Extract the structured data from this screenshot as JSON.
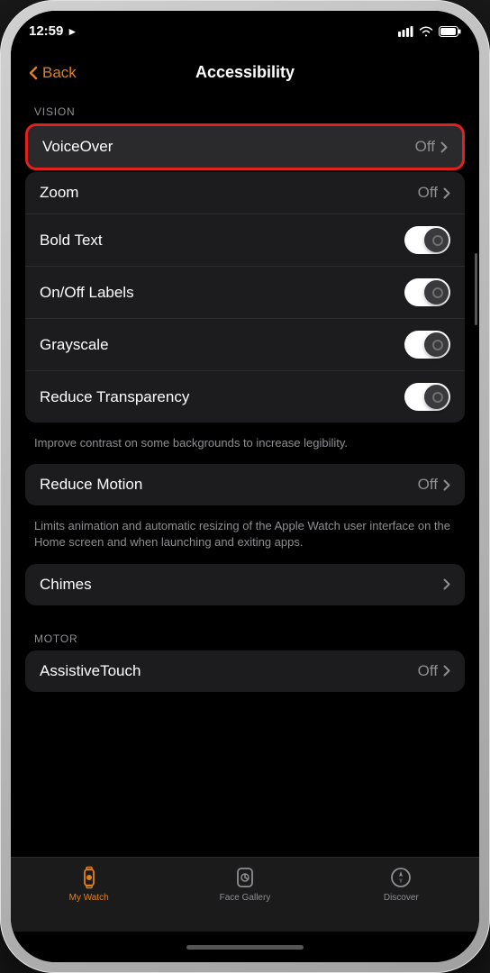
{
  "phone": {
    "status": {
      "time": "12:59",
      "location_icon": "▶",
      "signal": "●●●",
      "wifi": "wifi",
      "battery": "battery"
    }
  },
  "header": {
    "back_label": "Back",
    "title": "Accessibility"
  },
  "vision_section": {
    "header": "VISION",
    "items": [
      {
        "label": "VoiceOver",
        "value": "Off",
        "type": "chevron",
        "highlight": true
      },
      {
        "label": "Zoom",
        "value": "Off",
        "type": "chevron"
      },
      {
        "label": "Bold Text",
        "value": "",
        "type": "toggle"
      },
      {
        "label": "On/Off Labels",
        "value": "",
        "type": "toggle"
      },
      {
        "label": "Grayscale",
        "value": "",
        "type": "toggle"
      },
      {
        "label": "Reduce Transparency",
        "value": "",
        "type": "toggle"
      }
    ],
    "hint": "Improve contrast on some backgrounds to increase legibility."
  },
  "reduce_motion": {
    "label": "Reduce Motion",
    "value": "Off",
    "hint": "Limits animation and automatic resizing of the Apple Watch user interface on the Home screen and when launching and exiting apps."
  },
  "chimes": {
    "label": "Chimes"
  },
  "motor_section": {
    "header": "MOTOR",
    "items": [
      {
        "label": "AssistiveTouch",
        "value": "Off",
        "type": "chevron"
      }
    ]
  },
  "tab_bar": {
    "tabs": [
      {
        "label": "My Watch",
        "active": true
      },
      {
        "label": "Face Gallery",
        "active": false
      },
      {
        "label": "Discover",
        "active": false
      }
    ]
  }
}
